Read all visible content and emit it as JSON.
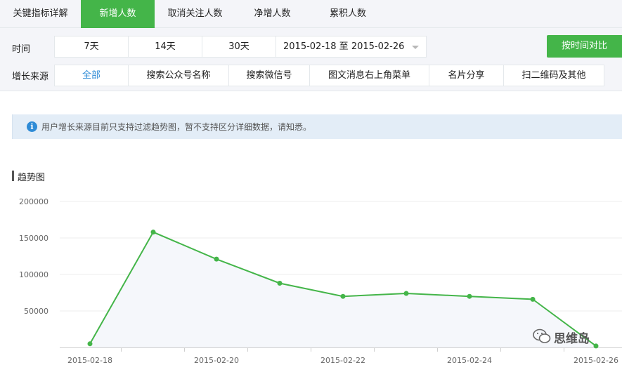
{
  "tabs": [
    {
      "label": "关键指标详解",
      "active": false
    },
    {
      "label": "新增人数",
      "active": true
    },
    {
      "label": "取消关注人数",
      "active": false
    },
    {
      "label": "净增人数",
      "active": false
    },
    {
      "label": "累积人数",
      "active": false
    }
  ],
  "filters": {
    "time_label": "时间",
    "time_options": [
      "7天",
      "14天",
      "30天"
    ],
    "date_range": "2015-02-18 至 2015-02-26",
    "compare_button": "按时间对比",
    "source_label": "增长来源",
    "source_options": [
      "全部",
      "搜索公众号名称",
      "搜索微信号",
      "图文消息右上角菜单",
      "名片分享",
      "扫二维码及其他"
    ],
    "source_selected": "全部"
  },
  "notice": {
    "icon": "info-icon",
    "text": "用户增长来源目前只支持过滤趋势图，暂不支持区分详细数据，请知悉。"
  },
  "chart_section": {
    "title": "趋势图"
  },
  "chart_data": {
    "type": "area",
    "title": "",
    "xlabel": "",
    "ylabel": "",
    "x": [
      "2015-02-18",
      "2015-02-19",
      "2015-02-20",
      "2015-02-21",
      "2015-02-22",
      "2015-02-23",
      "2015-02-24",
      "2015-02-25",
      "2015-02-26"
    ],
    "x_tick_labels": [
      "2015-02-18",
      "2015-02-20",
      "2015-02-22",
      "2015-02-24",
      "2015-02-26"
    ],
    "y_tick_labels": [
      "200000",
      "150000",
      "100000",
      "50000"
    ],
    "ylim": [
      0,
      200000
    ],
    "series": [
      {
        "values": [
          5000,
          158000,
          121000,
          88000,
          70000,
          74000,
          70000,
          66000,
          2000
        ]
      }
    ],
    "grid": true,
    "colors": {
      "line": "#44b549",
      "fill": "#f5f7fb",
      "grid": "#ececec"
    }
  },
  "watermark": {
    "text": "思维岛",
    "icon": "wechat-icon"
  },
  "colors": {
    "accent": "#44b549",
    "link": "#2e8bd6",
    "notice_bg": "#e3edf7"
  }
}
